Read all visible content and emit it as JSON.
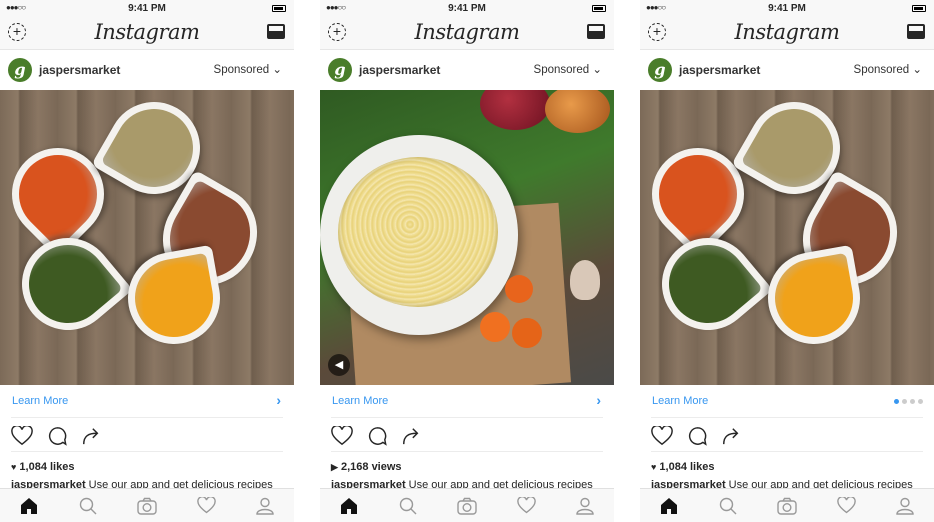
{
  "status": {
    "signal": "●●●○○",
    "time": "9:41 PM"
  },
  "app_title": "Instagram",
  "colors": {
    "accent": "#3897f0",
    "avatar": "#4a7d2a"
  },
  "phones": [
    {
      "username": "jaspersmarket",
      "sponsored": "Sponsored",
      "cta": "Learn More",
      "cta_indicator": "chevron-right-icon",
      "metric_icon": "heart-icon",
      "metric": "1,084 likes",
      "caption_user": "jaspersmarket",
      "caption": "Use our app and get delicious recipes",
      "media": "spices-photo"
    },
    {
      "username": "jaspersmarket",
      "sponsored": "Sponsored",
      "cta": "Learn More",
      "cta_indicator": "chevron-right-icon",
      "metric_icon": "play-icon",
      "metric": "2,168 views",
      "caption_user": "jaspersmarket",
      "caption": "Use our app and get delicious recipes",
      "media": "pasta-video"
    },
    {
      "username": "jaspersmarket",
      "sponsored": "Sponsored",
      "cta": "Learn More",
      "cta_indicator": "carousel-dots",
      "carousel": {
        "count": 4,
        "active": 1
      },
      "metric_icon": "heart-icon",
      "metric": "1,084 likes",
      "caption_user": "jaspersmarket",
      "caption": "Use our app and get delicious recipes",
      "media": "spices-photo"
    }
  ]
}
